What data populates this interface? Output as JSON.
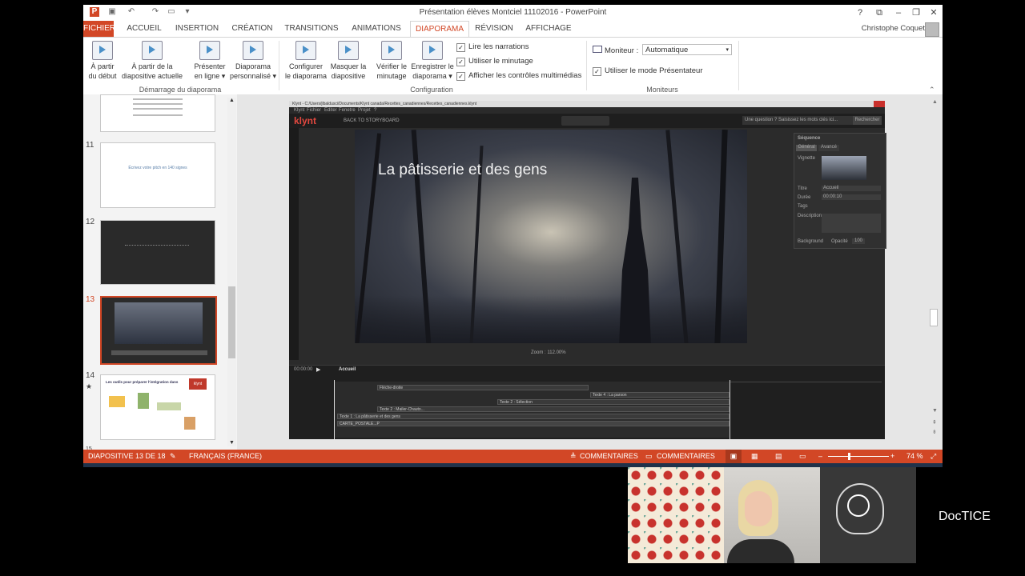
{
  "ppt": {
    "title": "Présentation élèves Montciel 11102016 - PowerPoint",
    "user": "Christophe Coquet",
    "tabs": [
      "FICHIER",
      "ACCUEIL",
      "INSERTION",
      "CRÉATION",
      "TRANSITIONS",
      "ANIMATIONS",
      "DIAPORAMA",
      "RÉVISION",
      "AFFICHAGE"
    ],
    "active_tab": "DIAPORAMA",
    "ribbon": {
      "from_start": [
        "À partir",
        "du début"
      ],
      "from_current": [
        "À partir de la",
        "diapositive actuelle"
      ],
      "present_online": [
        "Présenter",
        "en ligne ▾"
      ],
      "custom_show": [
        "Diaporama",
        "personnalisé ▾"
      ],
      "group1_label": "Démarrage du diaporama",
      "setup_show": [
        "Configurer",
        "le diaporama"
      ],
      "hide_slide": [
        "Masquer la",
        "diapositive"
      ],
      "rehearse": [
        "Vérifier le",
        "minutage"
      ],
      "record": [
        "Enregistrer le",
        "diaporama ▾"
      ],
      "play_narrations": "Lire les narrations",
      "use_timings": "Utiliser le minutage",
      "show_media_controls": "Afficher les contrôles multimédias",
      "group2_label": "Configuration",
      "monitor_label": "Moniteur :",
      "monitor_value": "Automatique",
      "presenter_view": "Utiliser le mode Présentateur",
      "group3_label": "Moniteurs"
    },
    "slides": [
      {
        "num": "11",
        "text": "Écrivez votre pitch en 140 signes"
      },
      {
        "num": "12"
      },
      {
        "num": "13"
      },
      {
        "num": "14",
        "text": "Les outils pour préparer l'intégration dans",
        "badge": "klynt",
        "star": "★"
      },
      {
        "num": "15"
      }
    ],
    "status": {
      "slide_info": "DIAPOSITIVE 13 DE 18",
      "language": "FRANÇAIS (FRANCE)",
      "notes": "COMMENTAIRES",
      "comments": "COMMENTAIRES",
      "zoom": "74 %"
    }
  },
  "klynt": {
    "window_title": "Klynt - C:/Users/jlbaldusci/Documents/Klynt canada/Recettes_canadiennes/Recettes_canadiennes.klynt",
    "logo": "klynt",
    "menu": [
      "Klynt",
      "Fichier",
      "Editer",
      "Fenetre",
      "Projet",
      "?"
    ],
    "back": "BACK TO STORYBOARD",
    "search_placeholder": "Une question ? Saisissez les mots clés ici...",
    "search_button": "Rechercher",
    "overlay_title": "La pâtisserie et des gens",
    "zoom_readout": "Zoom : 112.00%",
    "props_title": "Séquence",
    "props_tabs": [
      "Général",
      "Avancé"
    ],
    "props": {
      "thumb": "Vignette",
      "title_lbl": "Titre",
      "title_val": "Accueil",
      "duration_lbl": "Durée",
      "duration_val": "00:00:10",
      "tags_lbl": "Tags",
      "desc_lbl": "Description",
      "bg_lbl": "Background",
      "opacity_lbl": "Opacité",
      "opacity_val": "100"
    },
    "timecode": "00:00:00",
    "sequence": "Accueil",
    "tracks": [
      "Flèche-droite",
      "Texte 4 : La parson",
      "Texte 2 : Sélection",
      "Texte 2 : Mailer-Chauto...",
      "Texte 1 : La pâtisserie et des gens",
      "CARTE_POSTALE...P"
    ]
  },
  "brand": "DocTICE",
  "colors": {
    "accent": "#d24726"
  }
}
